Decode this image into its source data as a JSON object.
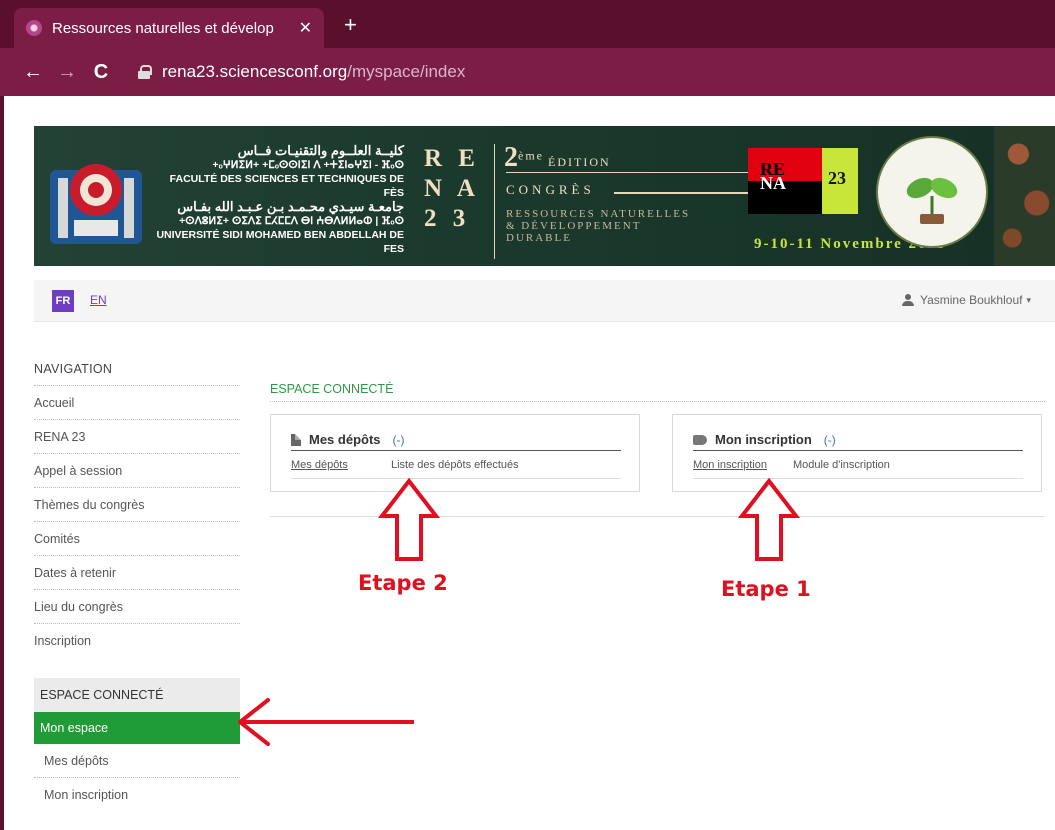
{
  "browser": {
    "tab_title": "Ressources naturelles et dévelop",
    "tab_close": "✕",
    "new_tab": "+",
    "back": "←",
    "forward": "→",
    "reload": "C",
    "url_host": "rena23.sciencesconf.org",
    "url_path": "/myspace/index"
  },
  "banner": {
    "arabic_line1": "كليــة العلــوم والتقنيـات فــاس",
    "tifinagh_line1": "+ₒⵖⵍⵉⵍ+ +ⵎₒⵙⵙⵏⵉⵏ ⴷ +ⵜⵉⵏⴰⵖⵉⵏ - ⴼₒⵙ",
    "faculty_fr": "FACULTÉ DES SCIENCES ET TECHNIQUES DE FÈS",
    "arabic_line2": "جامعـة سيـدي محـمـد بـن عـبـد الله بفـاس",
    "tifinagh_line2": "+ⵙⴷⵓⵍⵉ+ ⵙⵉⴷⵉ ⵎⵃⵎⵎⴷ ⴱⵏ ⵄⴱⴷⵍⵍⴰⵀ | ⴼₒⵙ",
    "university_fr": "UNIVERSITÉ SIDI MOHAMED BEN ABDELLAH DE FES",
    "rena": [
      "R E",
      "N A",
      "2 3"
    ],
    "edition_number": "2",
    "edition_sup": "ème",
    "edition_word": "ÉDITION",
    "congres": "CONGRÈS",
    "ressources_line1": "RESSOURCES NATURELLES",
    "ressources_line2": "& DÉVELOPPEMENT",
    "ressources_line3": "DURABLE",
    "flag_r1": "RE",
    "flag_r2": "NA",
    "flag_num": "23",
    "dates": "9-10-11 Novembre 2023"
  },
  "langbar": {
    "fr": "FR",
    "en": "EN",
    "user_name": "Yasmine Boukhlouf",
    "caret": "▾"
  },
  "sidebar": {
    "nav_heading": "NAVIGATION",
    "items": [
      "Accueil",
      "RENA 23",
      "Appel à session",
      "Thèmes du congrès",
      "Comités",
      "Dates à retenir",
      "Lieu du congrès",
      "Inscription"
    ],
    "space_heading": "ESPACE CONNECTÉ",
    "active": "Mon espace",
    "sub_items": [
      "Mes dépôts",
      "Mon inscription"
    ]
  },
  "main": {
    "title": "ESPACE CONNECTÉ",
    "panels": [
      {
        "title": "Mes dépôts",
        "count": "(-)",
        "link": "Mes dépôts",
        "desc": "Liste des dépôts effectués"
      },
      {
        "title": "Mon inscription",
        "count": "(-)",
        "link": "Mon inscription",
        "desc": "Module d'inscription"
      }
    ]
  },
  "annotations": {
    "step2": "Etape 2",
    "step1": "Etape 1",
    "arrow_color": "#e01020"
  }
}
